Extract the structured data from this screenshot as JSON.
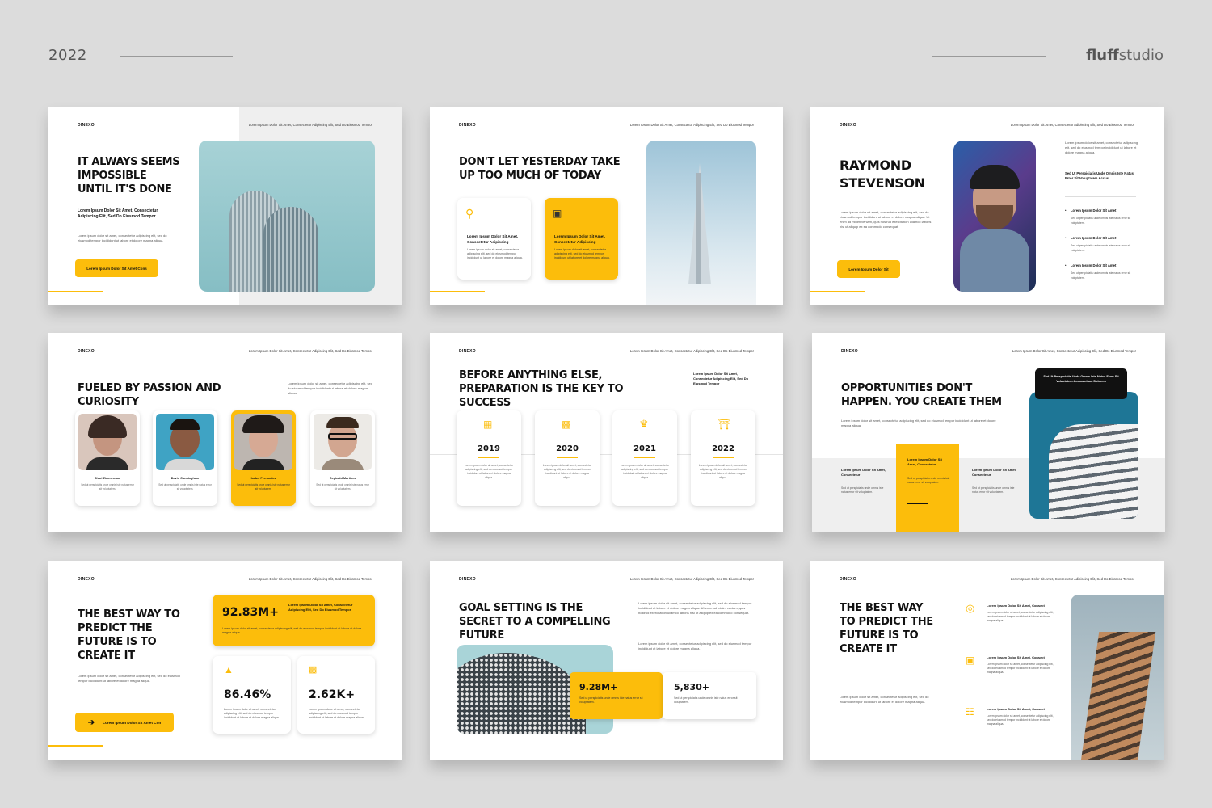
{
  "header": {
    "year": "2022",
    "brand_bold": "fluff",
    "brand_rest": "studio"
  },
  "brand_small": "DINEXO",
  "slide_header": "Lorem Ipsum Dolor Sit Amet, Consectetur Adipiscing Elit, Sed Do Eiusmod Tempor",
  "lorem": {
    "short": "Lorem ipsum dolor sit amet, consectetur adipiscing elit, sed do eiusmod tempor incididunt ut labore et dolore magna aliqua.",
    "long": "Lorem ipsum dolor sit amet, consectetur adipiscing elit, sed do eiusmod tempor incididunt ut labore et dolore magna aliqua. Ut enim ad minim veniam, quis nostrud exercitation ullamco laboris nisi ut aliquip ex ea commodo consequat.",
    "mini": "Sed ut perspiciatis unde omnis iste natus error sit voluptatem."
  },
  "s1": {
    "title": "IT ALWAYS SEEMS IMPOSSIBLE UNTIL IT'S DONE",
    "sub": "Lorem Ipsum Dolor Sit Amet, Consectetur Adipiscing Elit, Sed Do Eiusmod Tempor",
    "button": "Lorem Ipsum Dolor Sit Amet Cons"
  },
  "s2": {
    "title": "DON'T LET YESTERDAY TAKE UP TOO MUCH OF TODAY",
    "card1_title": "Lorem Ipsum Dolor Sit Amet, Consectetur Adipiscing",
    "card2_title": "Lorem Ipsum Dolor Sit Amet, Consectetur Adipiscing"
  },
  "s3": {
    "title": "RAYMOND STEVENSON",
    "button": "Lorem Ipsum Dolor Sit",
    "right_sub": "Sed Ut Perspiciatis Unde Omnis Iste Natus Error Sit Voluptatem Accus",
    "list": [
      "Lorem Ipsum Dolor Sit Amet",
      "Lorem Ipsum Dolor Sit Amet",
      "Lorem Ipsum Dolor Sit Amet"
    ]
  },
  "s4": {
    "title": "FUELED BY PASSION AND CURIOSITY",
    "people": [
      {
        "name": "Shari Zimmerman"
      },
      {
        "name": "Devin Cunningham"
      },
      {
        "name": "Isabel Fernandez"
      },
      {
        "name": "Reginald Martinez"
      }
    ]
  },
  "s5": {
    "title": "BEFORE ANYTHING ELSE, PREPARATION IS THE KEY TO SUCCESS",
    "side": "Lorem Ipsum Dolor Sit Amet, Consectetur Adipiscing Elit, Sed Do Eiusmod Tempor",
    "years": [
      "2019",
      "2020",
      "2021",
      "2022"
    ]
  },
  "s6": {
    "title": "OPPORTUNITIES DON'T HAPPEN. YOU CREATE THEM",
    "tooltip": "Sed Ut Perspiciatis Unde Omnis Iste Natus Error Sit Voluptatem Accusantium Dolorem",
    "col_title": "Lorem Ipsum Dolor Sit Amet, Consectetur"
  },
  "s7": {
    "title": "THE BEST WAY TO PREDICT THE FUTURE IS TO CREATE IT",
    "stat1": "92.83M+",
    "stat1_title": "Lorem Ipsum Dolor Sit Amet, Consectetur Adipiscing Elit, Sed Do Eiusmod Tempor",
    "stat2": "86.46%",
    "stat3": "2.62K+",
    "button": "Lorem Ipsum Dolor Sit Amet Con"
  },
  "s8": {
    "title": "GOAL SETTING IS THE SECRET TO A COMPELLING FUTURE",
    "stat1": "9.28M+",
    "stat2": "5,830+"
  },
  "s9": {
    "title": "THE BEST WAY TO PREDICT THE FUTURE IS TO CREATE IT",
    "item_title": "Lorem Ipsum Dolor Sit Amet, Consect"
  },
  "colors": {
    "accent": "#fcbd0b",
    "teal": "#1e7696",
    "bg": "#dcdcdc"
  }
}
